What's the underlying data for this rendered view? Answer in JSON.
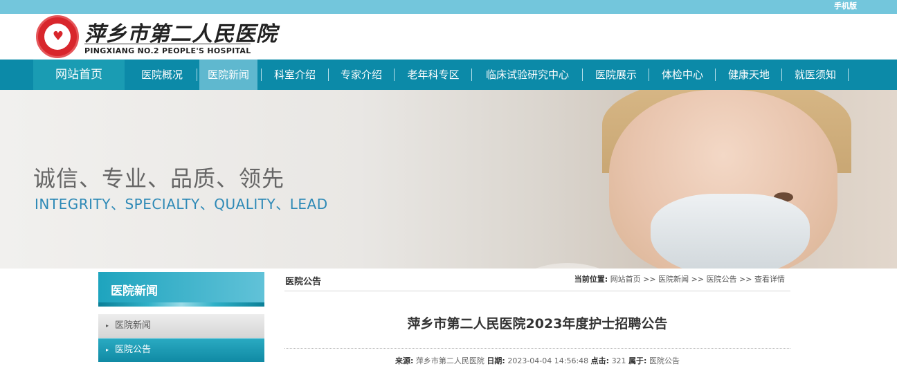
{
  "topbar": {
    "mobile_label": "手机版"
  },
  "logo": {
    "name_cn": "萍乡市第二人民医院",
    "name_en": "PINGXIANG NO.2 PEOPLE'S HOSPITAL"
  },
  "nav": {
    "home": "网站首页",
    "items": [
      "医院概况",
      "医院新闻",
      "科室介绍",
      "专家介绍",
      "老年科专区",
      "临床试验研究中心",
      "医院展示",
      "体检中心",
      "健康天地",
      "就医须知"
    ],
    "active_index": 1
  },
  "banner": {
    "slogan_cn": "诚信、专业、品质、领先",
    "slogan_en": "INTEGRITY、SPECIALTY、QUALITY、LEAD"
  },
  "sidebar": {
    "title": "医院新闻",
    "items": [
      {
        "label": "医院新闻",
        "arrow": "▸"
      },
      {
        "label": "医院公告",
        "arrow": "▸"
      }
    ]
  },
  "content": {
    "category": "医院公告",
    "breadcrumb": {
      "prefix": "当前位置:",
      "items": [
        "网站首页",
        "医院新闻",
        "医院公告",
        "查看详情"
      ],
      "separator": ">>"
    },
    "title": "萍乡市第二人民医院2023年度护士招聘公告",
    "meta": {
      "source_label": "来源:",
      "source": "萍乡市第二人民医院",
      "date_label": "日期:",
      "date": "2023-04-04 14:56:48",
      "clicks_label": "点击:",
      "clicks": "321",
      "belongs_label": "属于:",
      "belongs": "医院公告"
    }
  }
}
